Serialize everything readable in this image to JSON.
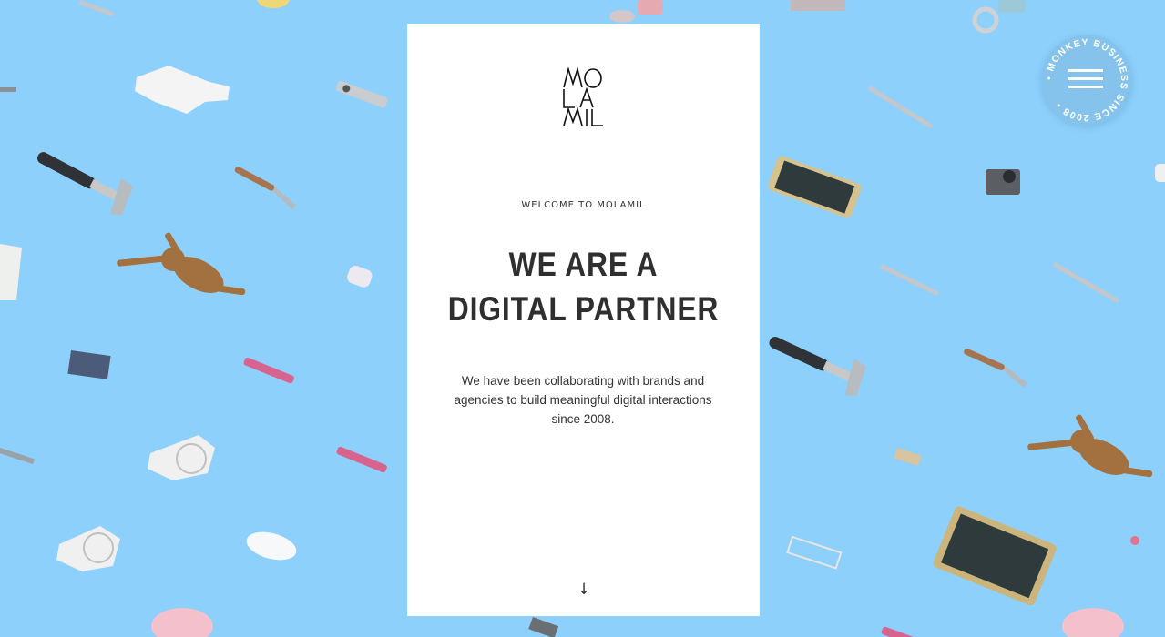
{
  "brand": {
    "logo_lines": [
      "MO",
      "LA",
      "MIL"
    ]
  },
  "hero": {
    "eyebrow": "WELCOME TO MOLAMIL",
    "headline_line1": "WE ARE A",
    "headline_line2": "DIGITAL PARTNER",
    "intro": "We have been collaborating with brands and agencies to build meaningful digital interactions since 2008.",
    "scroll_arrow": "↓"
  },
  "badge": {
    "ring_text": "• MONKEY BUSINESS SINCE 2008 •",
    "icon": "hamburger-menu-icon"
  },
  "background": {
    "color": "#8dd0fc",
    "objects": [
      "hammer",
      "glove",
      "remote",
      "scalpel",
      "spatula",
      "wooden-monkey",
      "eraser",
      "paper-cup",
      "microchip",
      "pink-stick",
      "wire-spool",
      "mouse",
      "piggy-bank",
      "phone",
      "camera",
      "tablet",
      "paper-clip",
      "bulldog-clip",
      "pencil-sharpener"
    ]
  },
  "colors": {
    "card": "#ffffff",
    "text": "#2f2f2f",
    "badge": "#85c3ec"
  }
}
